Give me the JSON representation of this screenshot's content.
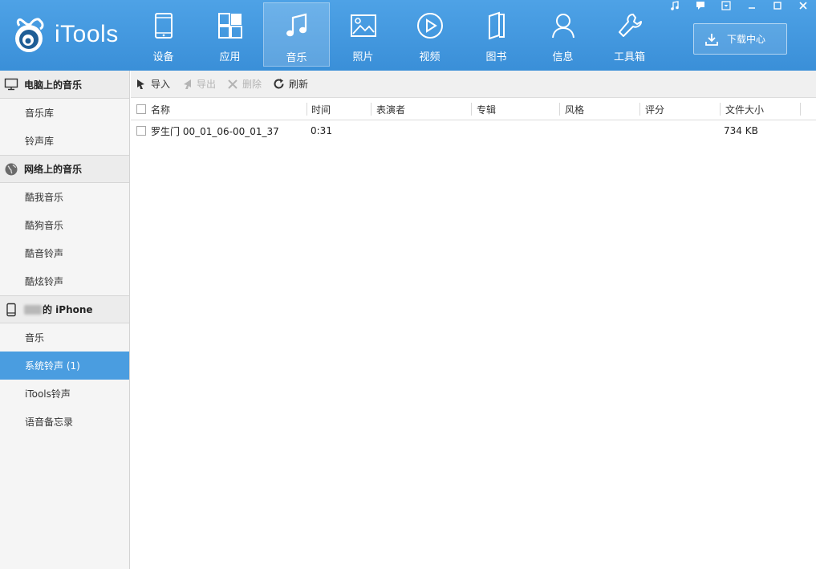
{
  "app": {
    "name": "iTools"
  },
  "nav": [
    {
      "id": "device",
      "label": "设备",
      "icon": "device-icon"
    },
    {
      "id": "apps",
      "label": "应用",
      "icon": "apps-icon"
    },
    {
      "id": "music",
      "label": "音乐",
      "icon": "music-icon",
      "active": true
    },
    {
      "id": "photos",
      "label": "照片",
      "icon": "photo-icon"
    },
    {
      "id": "video",
      "label": "视频",
      "icon": "video-icon"
    },
    {
      "id": "books",
      "label": "图书",
      "icon": "book-icon"
    },
    {
      "id": "info",
      "label": "信息",
      "icon": "contact-icon"
    },
    {
      "id": "tools",
      "label": "工具箱",
      "icon": "wrench-icon"
    }
  ],
  "download_center": {
    "label": "下载中心",
    "icon": "download-icon"
  },
  "window_controls": [
    "music-note-icon",
    "feedback-icon",
    "menu-icon",
    "minimize-icon",
    "maximize-icon",
    "close-icon"
  ],
  "sidebar": {
    "pc_music": {
      "title": "电脑上的音乐",
      "icon": "monitor-icon",
      "items": [
        "音乐库",
        "铃声库"
      ]
    },
    "web_music": {
      "title": "网络上的音乐",
      "icon": "globe-icon",
      "items": [
        "酷我音乐",
        "酷狗音乐",
        "酷音铃声",
        "酷炫铃声"
      ]
    },
    "device_music": {
      "title_suffix": "的 iPhone",
      "icon": "phone-icon",
      "items": [
        "音乐",
        "系统铃声 (1)",
        "iTools铃声",
        "语音备忘录"
      ],
      "selected_index": 1
    }
  },
  "toolbar": {
    "import": "导入",
    "export": "导出",
    "delete": "删除",
    "refresh": "刷新"
  },
  "table": {
    "columns": [
      "名称",
      "时间",
      "表演者",
      "专辑",
      "风格",
      "评分",
      "文件大小"
    ],
    "rows": [
      {
        "name": "罗生门 00_01_06-00_01_37",
        "time": "0:31",
        "artist": "",
        "album": "",
        "genre": "",
        "rating": "",
        "size": "734 KB"
      }
    ]
  },
  "colors": {
    "accent": "#3a8fd8",
    "selected": "#4a9de0"
  }
}
